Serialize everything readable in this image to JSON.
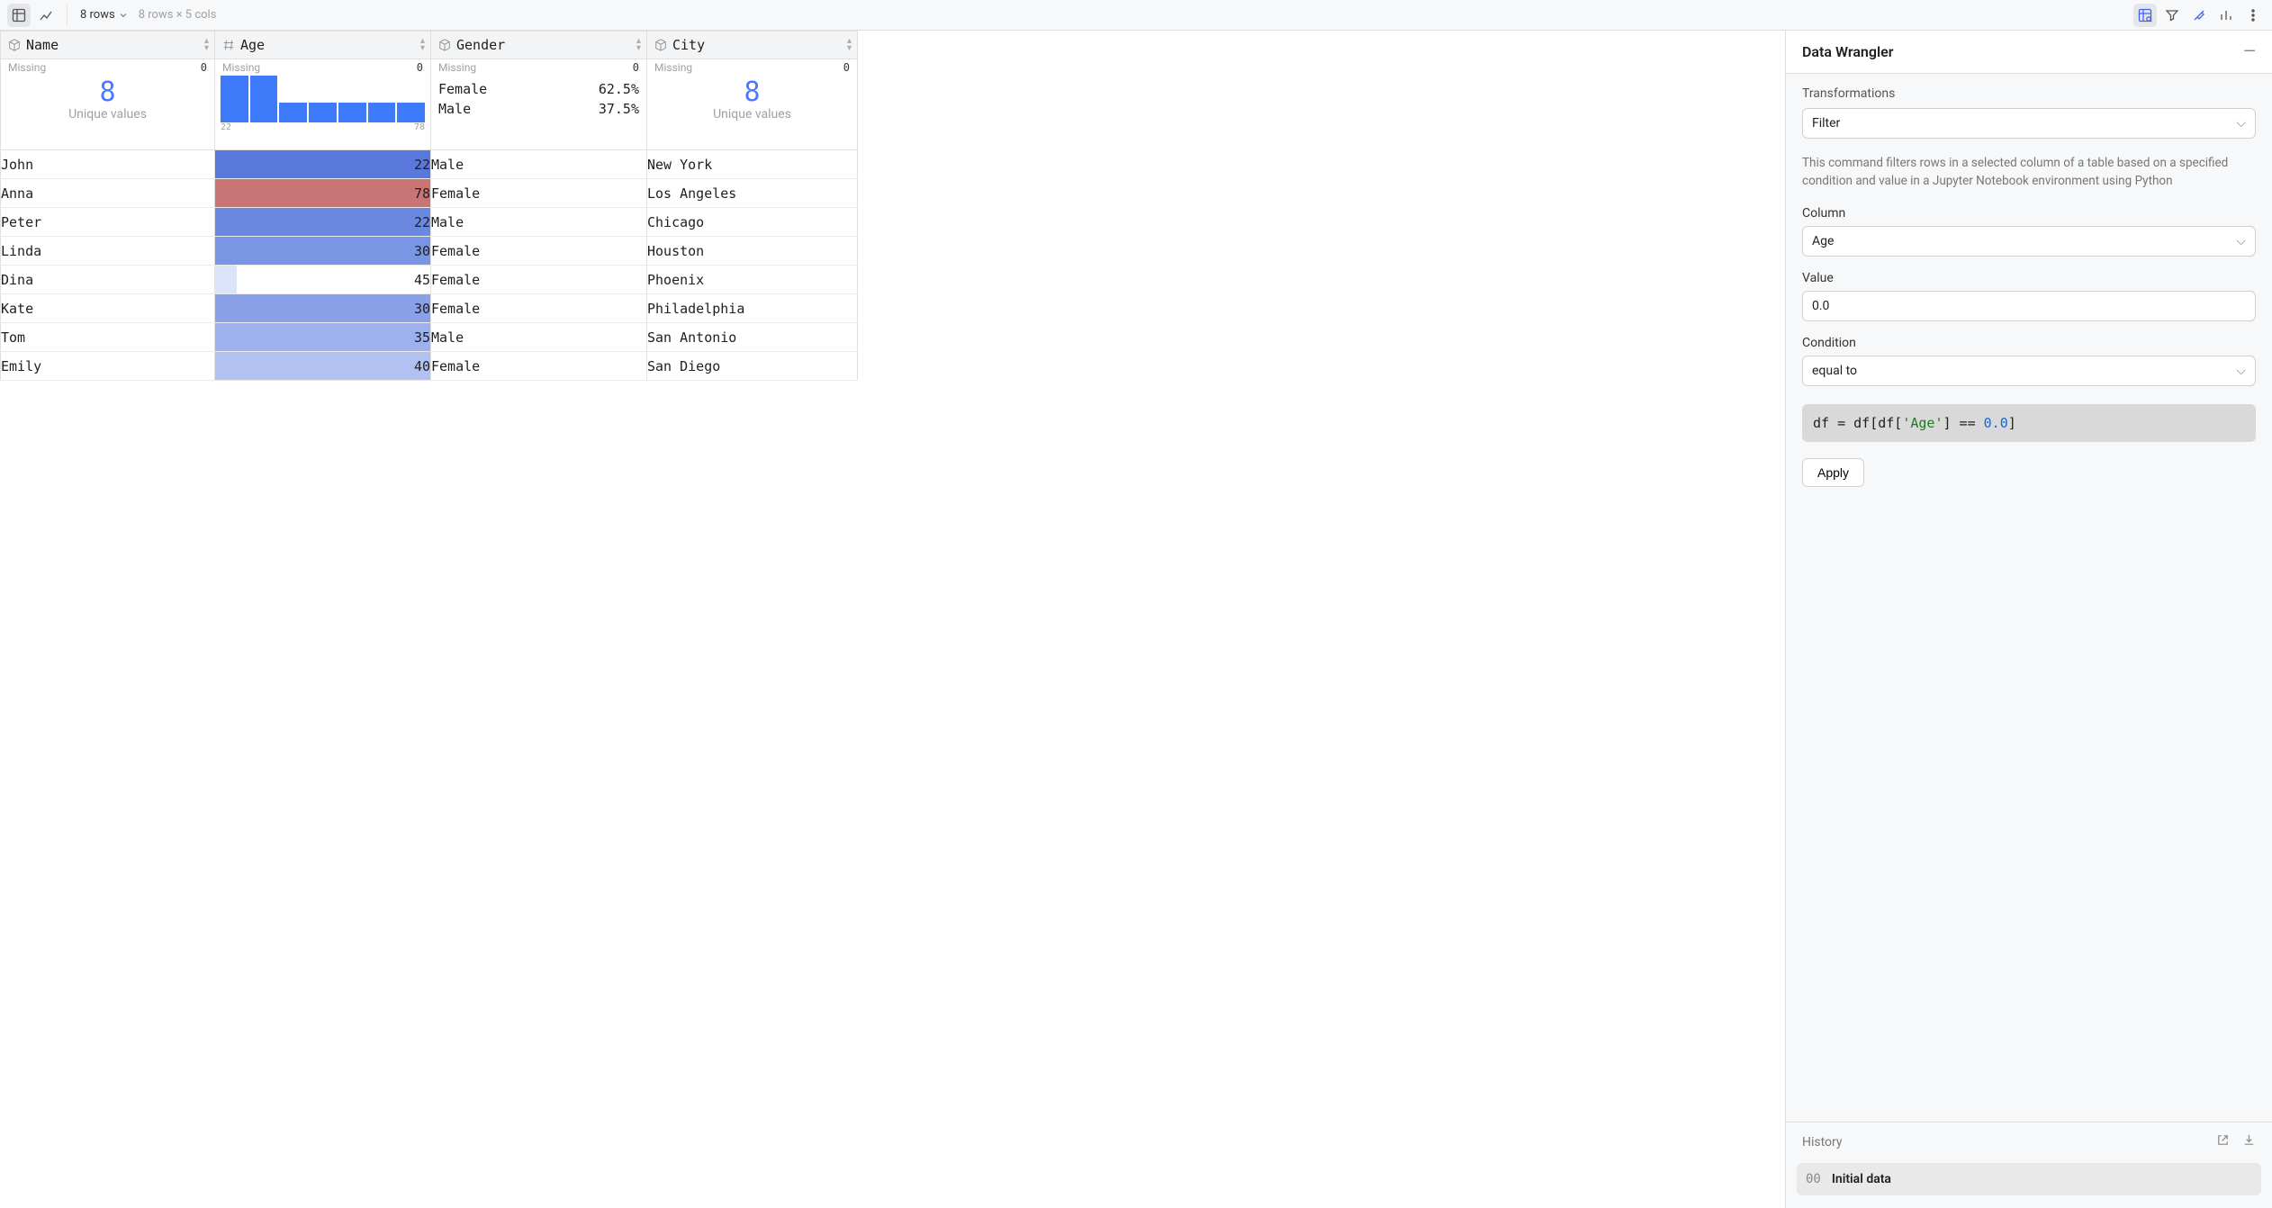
{
  "toolbar": {
    "rows_chip": "8 rows",
    "dims": "8 rows × 5 cols"
  },
  "columns": [
    {
      "name": "Name",
      "type": "categorical",
      "missing_label": "Missing",
      "missing": "0",
      "unique_count": "8",
      "unique_label": "Unique values"
    },
    {
      "name": "Age",
      "type": "numeric",
      "missing_label": "Missing",
      "missing": "0",
      "hist_fracs": [
        1.0,
        1.0,
        0.42,
        0.42,
        0.42,
        0.42,
        0.42
      ],
      "hist_min": "22",
      "hist_max": "78"
    },
    {
      "name": "Gender",
      "type": "categorical",
      "missing_label": "Missing",
      "missing": "0",
      "dist": [
        {
          "label": "Female",
          "pct": "62.5%"
        },
        {
          "label": "Male",
          "pct": "37.5%"
        }
      ]
    },
    {
      "name": "City",
      "type": "categorical",
      "missing_label": "Missing",
      "missing": "0",
      "unique_count": "8",
      "unique_label": "Unique values"
    }
  ],
  "rows": [
    {
      "name": "John",
      "age": "22",
      "age_fill": 1.0,
      "age_color": "#5878db",
      "gender": "Male",
      "city": "New York"
    },
    {
      "name": "Anna",
      "age": "78",
      "age_fill": 1.0,
      "age_color": "#c97575",
      "gender": "Female",
      "city": "Los Angeles"
    },
    {
      "name": "Peter",
      "age": "22",
      "age_fill": 1.0,
      "age_color": "#6a88e0",
      "gender": "Male",
      "city": "Chicago"
    },
    {
      "name": "Linda",
      "age": "30",
      "age_fill": 1.0,
      "age_color": "#7a95e3",
      "gender": "Female",
      "city": "Houston"
    },
    {
      "name": "Dina",
      "age": "45",
      "age_fill": 0.1,
      "age_color": "#dbe4fb",
      "gender": "Female",
      "city": "Phoenix"
    },
    {
      "name": "Kate",
      "age": "30",
      "age_fill": 1.0,
      "age_color": "#8aa1e9",
      "gender": "Female",
      "city": "Philadelphia"
    },
    {
      "name": "Tom",
      "age": "35",
      "age_fill": 1.0,
      "age_color": "#9db1ee",
      "gender": "Male",
      "city": "San Antonio"
    },
    {
      "name": "Emily",
      "age": "40",
      "age_fill": 1.0,
      "age_color": "#b1c1f2",
      "gender": "Female",
      "city": "San Diego"
    }
  ],
  "panel": {
    "title": "Data Wrangler",
    "transformations_label": "Transformations",
    "transformation": "Filter",
    "description": "This command filters rows in a selected column of a table based on a specified condition and value in a Jupyter Notebook environment using Python",
    "column_label": "Column",
    "column_value": "Age",
    "value_label": "Value",
    "value_value": "0.0",
    "condition_label": "Condition",
    "condition_value": "equal to",
    "code_prefix": "df = df[df[",
    "code_key": "'Age'",
    "code_mid": "] == ",
    "code_num": "0.0",
    "code_suffix": "]",
    "apply_label": "Apply",
    "history_label": "History",
    "history_item_idx": "00",
    "history_item_name": "Initial data"
  }
}
